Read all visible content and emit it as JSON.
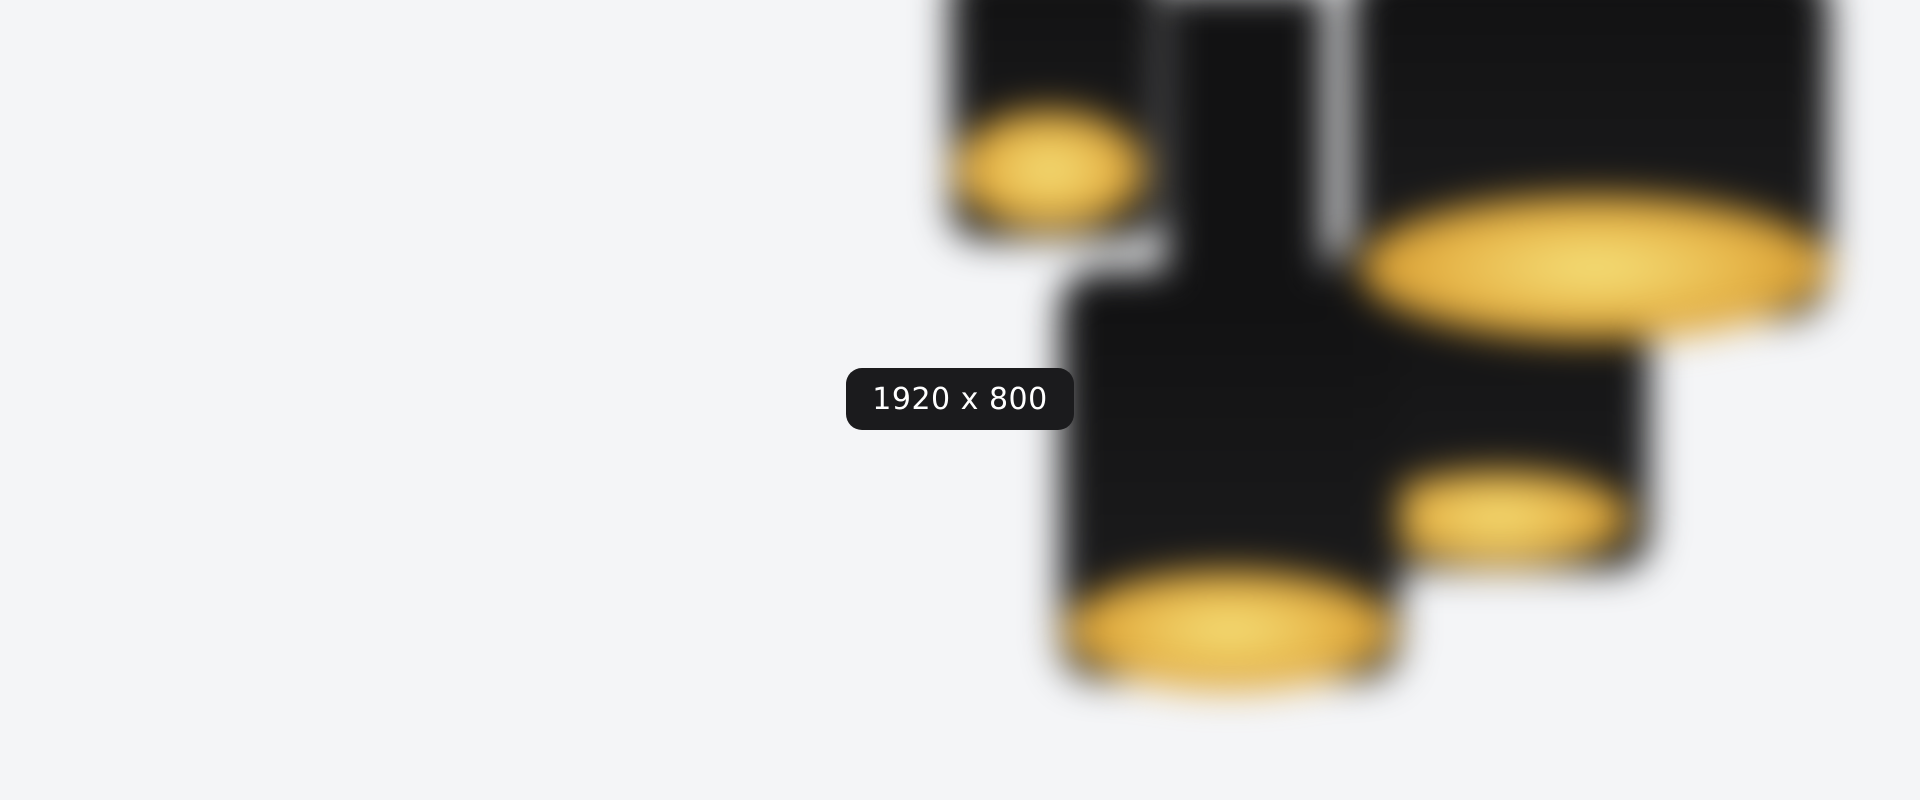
{
  "placeholder": {
    "size_label": "1920 x 800"
  },
  "colors": {
    "background": "#f4f5f7",
    "badge_background": "#1b1b1d",
    "badge_text": "#ffffff",
    "lamp_body": "#151516",
    "lamp_glow": "#e8b84c"
  }
}
